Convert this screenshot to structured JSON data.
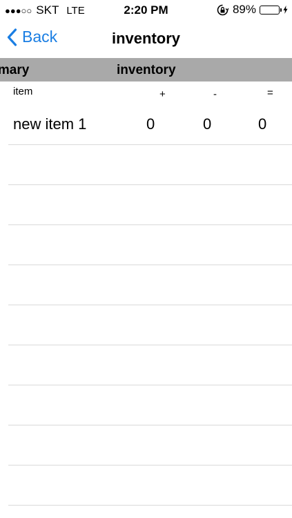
{
  "status_bar": {
    "signal": "●●●○○",
    "carrier": "SKT",
    "network": "LTE",
    "time": "2:20 PM",
    "battery_percent": "89%",
    "battery_level": 0.89,
    "battery_color": "#4cd964",
    "icons": [
      "orientation-lock-icon",
      "battery-icon",
      "charging-icon"
    ]
  },
  "nav": {
    "back_label": "Back",
    "title": "inventory",
    "accent_color": "#1a7ee3"
  },
  "segments": {
    "summary_label": "mmary",
    "inventory_label": "inventory",
    "bar_color": "#a9a9a9"
  },
  "columns": {
    "item": "item",
    "plus": "+",
    "minus": "-",
    "equal": "="
  },
  "rows": [
    {
      "name": "new item 1",
      "plus": "0",
      "minus": "0",
      "equal": "0"
    }
  ]
}
